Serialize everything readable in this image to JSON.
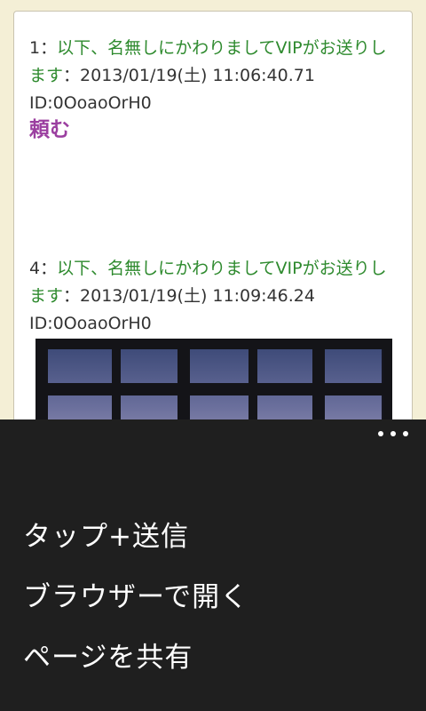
{
  "posts": [
    {
      "number": "1",
      "separator": "：",
      "name": "以下、名無しにかわりましてVIPがお送りします",
      "separator2": "：",
      "datetime": "2013/01/19(土) 11:06:40.71",
      "id": "ID:0OoaoOrH0",
      "body": "頼む"
    },
    {
      "number": "4",
      "separator": "：",
      "name": "以下、名無しにかわりましてVIPがお送りします",
      "separator2": "：",
      "datetime": "2013/01/19(土) 11:09:46.24",
      "id": "ID:0OoaoOrH0",
      "body": ""
    }
  ],
  "menu": {
    "items": [
      {
        "label": "タップ+送信"
      },
      {
        "label": "ブラウザーで開く"
      },
      {
        "label": "ページを共有"
      }
    ]
  },
  "icons": {
    "more": "more-icon"
  },
  "colors": {
    "name": "#2e8a2e",
    "body": "#9b3fa0",
    "menu_bg": "#1f1f1f",
    "page_bg": "#f4efd6"
  }
}
